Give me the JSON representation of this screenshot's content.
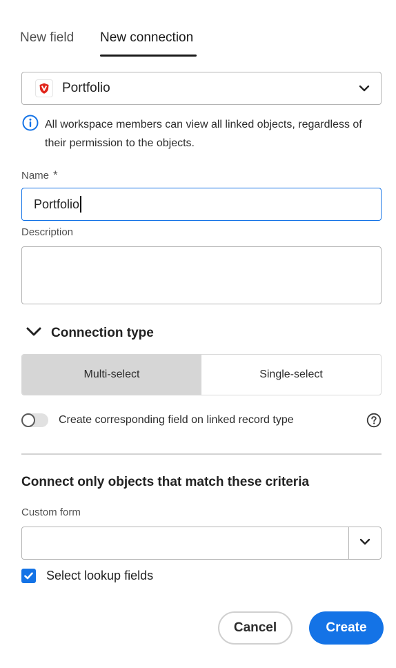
{
  "tabs": [
    {
      "label": "New field",
      "active": false
    },
    {
      "label": "New connection",
      "active": true
    }
  ],
  "object_select": {
    "value": "Portfolio",
    "icon": "portfolio-shield-icon",
    "icon_color": "#e1251b"
  },
  "info": {
    "text": "All workspace members can view all linked objects, regardless of their permission to the objects."
  },
  "name_field": {
    "label": "Name",
    "required_marker": "*",
    "value": "Portfolio"
  },
  "description_field": {
    "label": "Description",
    "value": ""
  },
  "connection_type": {
    "title": "Connection type",
    "options": [
      "Multi-select",
      "Single-select"
    ],
    "selected": "Multi-select"
  },
  "corresponding_field": {
    "label": "Create corresponding field on linked record type",
    "enabled": false
  },
  "criteria": {
    "title": "Connect only objects that match these criteria",
    "custom_form_label": "Custom form",
    "custom_form_value": ""
  },
  "lookup": {
    "label": "Select lookup fields",
    "checked": true
  },
  "buttons": {
    "cancel": "Cancel",
    "create": "Create"
  },
  "colors": {
    "accent": "#1473e6",
    "selected_segment": "#d6d6d6"
  }
}
